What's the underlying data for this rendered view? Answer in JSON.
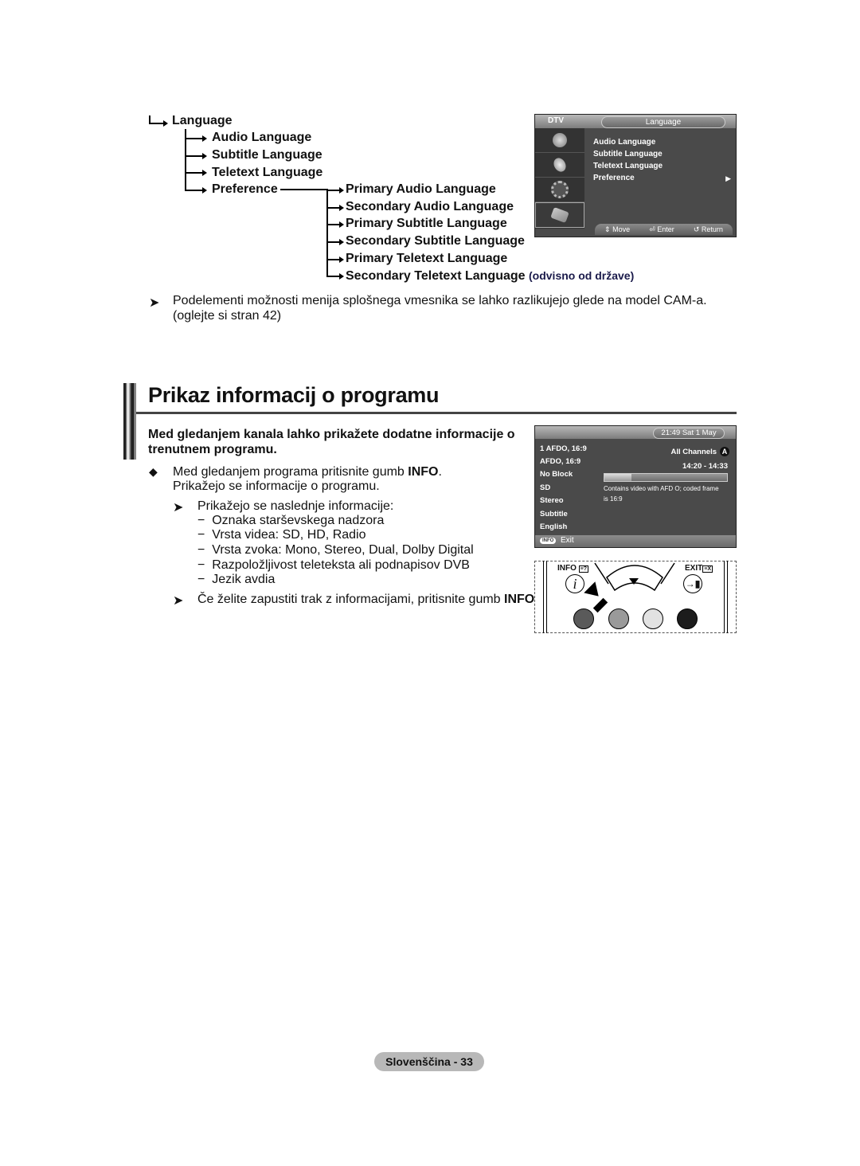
{
  "language_tree": {
    "root": "Language",
    "children": [
      "Audio Language",
      "Subtitle Language",
      "Teletext Language",
      "Preference"
    ],
    "preference_children": [
      "Primary Audio Language",
      "Secondary Audio Language",
      "Primary Subtitle Language",
      "Secondary Subtitle Language",
      "Primary Teletext Language",
      "Secondary Teletext Language"
    ],
    "note": "(odvisno od države)"
  },
  "language_osd": {
    "source": "DTV",
    "title": "Language",
    "items": [
      "Audio Language",
      "Subtitle Language",
      "Teletext Language",
      "Preference"
    ],
    "footer": {
      "move": "Move",
      "enter": "Enter",
      "return": "Return"
    }
  },
  "cam_note": {
    "line1": "Podelementi možnosti menija splošnega vmesnika se lahko razlikujejo glede na model CAM-a.",
    "line2": "(oglejte si stran 42)"
  },
  "section": {
    "title": "Prikaz informacij o programu",
    "intro_line1": "Med gledanjem kanala lahko prikažete dodatne informacije o",
    "intro_line2": "trenutnem programu.",
    "step_line1_pre": "Med gledanjem programa pritisnite gumb ",
    "step_line1_bold": "INFO",
    "step_line1_post": ".",
    "step_line2": "Prikažejo se informacije o programu.",
    "info_intro": "Prikažejo se naslednje informacije:",
    "info_items": [
      "Oznaka starševskega nadzora",
      "Vrsta videa: SD, HD, Radio",
      "Vrsta zvoka: Mono, Stereo, Dual, Dolby Digital",
      "Razpoložljivost teleteksta ali podnapisov DVB",
      "Jezik avdia"
    ],
    "exit_pre": "Če želite zapustiti trak z informacijami, pritisnite gumb ",
    "exit_bold": "INFO",
    "exit_post": "."
  },
  "info_osd": {
    "clock": "21:49 Sat 1 May",
    "left_lines": [
      "1 AFDO, 16:9",
      "AFDO, 16:9",
      "No Block",
      "SD",
      "Stereo",
      "Subtitle",
      "English"
    ],
    "channels": "All Channels",
    "channels_badge": "A",
    "time_range": "14:20 - 14:33",
    "progress": 0.22,
    "description_line1": "Contains video with AFD O; coded frame",
    "description_line2": "is 16:9",
    "footer_key": "INFO",
    "footer_label": "Exit"
  },
  "remote": {
    "info_label": "INFO",
    "exit_label": "EXIT",
    "info_glyph": "i",
    "colors": [
      "#5a5a5a",
      "#9a9a9a",
      "#e2e2e2",
      "#1c1c1c"
    ]
  },
  "footer": {
    "page_label": "Slovenščina - 33"
  }
}
